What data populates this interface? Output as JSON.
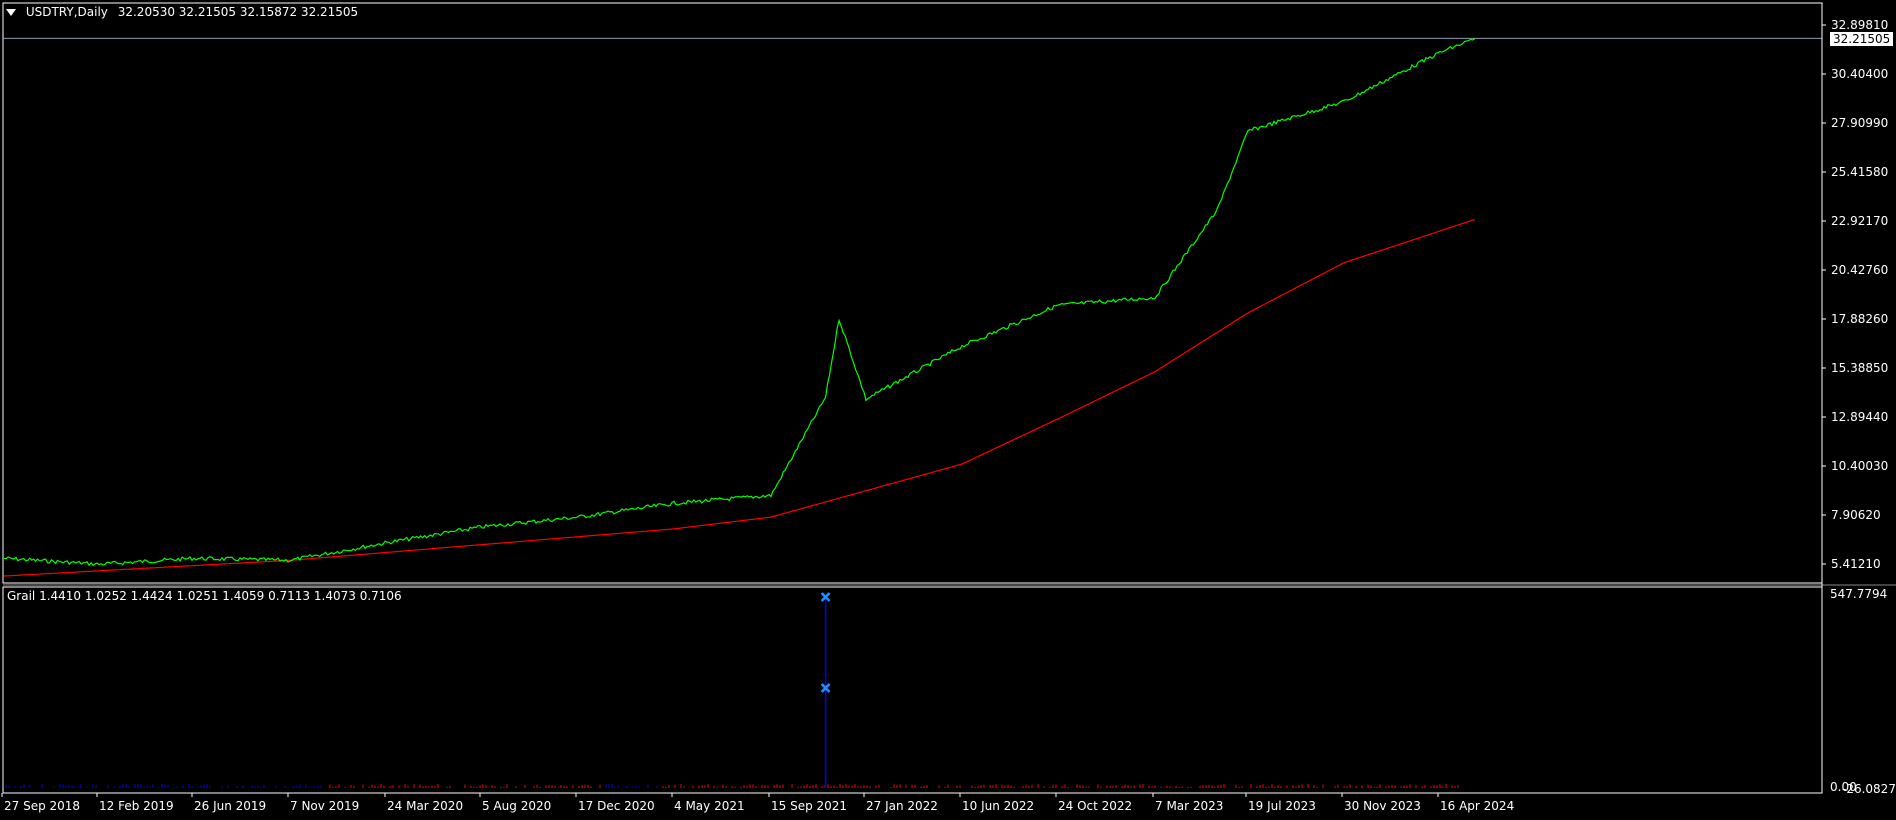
{
  "main_panel": {
    "title": "USDTRY,Daily",
    "ohlc": "32.20530 32.21505 32.15872 32.21505",
    "current_price_label": "32.21505",
    "price_axis_labels": [
      "32.89810",
      "30.40400",
      "27.90990",
      "25.41580",
      "22.92170",
      "20.42760",
      "17.88260",
      "15.38850",
      "12.89440",
      "10.40030",
      "7.90620",
      "5.41210"
    ]
  },
  "indicator_panel": {
    "title": "Grail 1.4410 1.0252 1.4424 1.0251 1.4059 0.7113 1.4073 0.7106",
    "axis_top_label": "547.7794",
    "axis_bottom_labels": [
      "0.00",
      "-26.0827"
    ]
  },
  "time_axis_labels": [
    "27 Sep 2018",
    "12 Feb 2019",
    "26 Jun 2019",
    "7 Nov 2019",
    "24 Mar 2020",
    "5 Aug 2020",
    "17 Dec 2020",
    "4 May 2021",
    "15 Sep 2021",
    "27 Jan 2022",
    "10 Jun 2022",
    "24 Oct 2022",
    "7 Mar 2023",
    "19 Jul 2023",
    "30 Nov 2023",
    "16 Apr 2024"
  ],
  "colors": {
    "background": "#000000",
    "price_line": "#00ff00",
    "moving_average": "#ff0000",
    "indicator_blue": "#0000ff",
    "indicator_red": "#ff0000",
    "marker": "#1e90ff",
    "grid_border": "#ffffff"
  },
  "chart_data": {
    "type": "line",
    "series": [
      {
        "values_x": [
          "27 Sep 2018",
          "12 Feb 2019",
          "26 Jun 2019",
          "7 Nov 2019",
          "24 Mar 2020",
          "5 Aug 2020",
          "17 Dec 2020",
          "4 May 2021",
          "15 Sep 2021",
          "1 Dec 2021",
          "20 Dec 2021",
          "27 Jan 2022",
          "10 Jun 2022",
          "24 Oct 2022",
          "7 Mar 2023",
          "5 Jun 2023",
          "19 Jul 2023",
          "30 Nov 2023",
          "16 Apr 2024",
          "5 Jun 2024"
        ],
        "values_y": [
          5.7,
          5.4,
          5.7,
          5.6,
          6.5,
          7.3,
          7.8,
          8.5,
          8.9,
          13.9,
          17.9,
          13.8,
          16.5,
          18.6,
          19.0,
          23.5,
          27.5,
          29.0,
          31.5,
          32.2
        ]
      },
      {
        "values_x": [
          "27 Sep 2018",
          "7 Nov 2019",
          "5 Aug 2020",
          "4 May 2021",
          "15 Sep 2021",
          "10 Jun 2022",
          "24 Oct 2022",
          "7 Mar 2023",
          "19 Jul 2023",
          "30 Nov 2023",
          "5 Jun 2024"
        ],
        "values_y": [
          4.8,
          5.6,
          6.4,
          7.2,
          7.8,
          10.5,
          12.8,
          15.2,
          18.2,
          20.8,
          23.0
        ]
      }
    ],
    "indicator": {
      "spike_date": "1 Dec 2021",
      "spike_value": 547.7794,
      "marker_values": [
        547.7794,
        287.0
      ]
    }
  }
}
